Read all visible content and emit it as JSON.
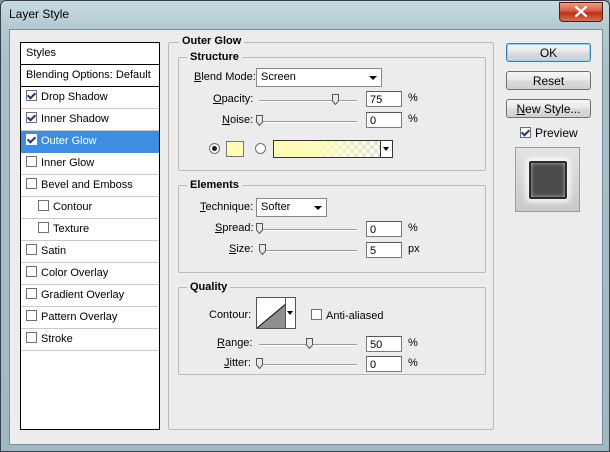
{
  "window": {
    "title": "Layer Style"
  },
  "styles_panel": {
    "header": "Styles",
    "blending_options": "Blending Options: Default",
    "items": [
      {
        "label": "Drop Shadow",
        "checked": true,
        "selected": false,
        "indent": false
      },
      {
        "label": "Inner Shadow",
        "checked": true,
        "selected": false,
        "indent": false
      },
      {
        "label": "Outer Glow",
        "checked": true,
        "selected": true,
        "indent": false
      },
      {
        "label": "Inner Glow",
        "checked": false,
        "selected": false,
        "indent": false
      },
      {
        "label": "Bevel and Emboss",
        "checked": false,
        "selected": false,
        "indent": false
      },
      {
        "label": "Contour",
        "checked": false,
        "selected": false,
        "indent": true
      },
      {
        "label": "Texture",
        "checked": false,
        "selected": false,
        "indent": true
      },
      {
        "label": "Satin",
        "checked": false,
        "selected": false,
        "indent": false
      },
      {
        "label": "Color Overlay",
        "checked": false,
        "selected": false,
        "indent": false
      },
      {
        "label": "Gradient Overlay",
        "checked": false,
        "selected": false,
        "indent": false
      },
      {
        "label": "Pattern Overlay",
        "checked": false,
        "selected": false,
        "indent": false
      },
      {
        "label": "Stroke",
        "checked": false,
        "selected": false,
        "indent": false
      }
    ]
  },
  "outer_glow": {
    "title": "Outer Glow",
    "structure": {
      "title": "Structure",
      "blend_mode_label": "Blend Mode:",
      "blend_mode_value": "Screen",
      "opacity_label": "Opacity:",
      "opacity_value": "75",
      "opacity_unit": "%",
      "noise_label": "Noise:",
      "noise_value": "0",
      "noise_unit": "%",
      "glow_color": "#fefcb8"
    },
    "elements": {
      "title": "Elements",
      "technique_label": "Technique:",
      "technique_value": "Softer",
      "spread_label": "Spread:",
      "spread_value": "0",
      "spread_unit": "%",
      "size_label": "Size:",
      "size_value": "5",
      "size_unit": "px"
    },
    "quality": {
      "title": "Quality",
      "contour_label": "Contour:",
      "anti_aliased_label": "Anti-aliased",
      "range_label": "Range:",
      "range_value": "50",
      "range_unit": "%",
      "jitter_label": "Jitter:",
      "jitter_value": "0",
      "jitter_unit": "%"
    }
  },
  "buttons": {
    "ok": "OK",
    "reset": "Reset",
    "new_style": "New Style...",
    "preview_label": "Preview"
  },
  "colors": {
    "selection": "#3d8ee0",
    "glow": "#fefcb8"
  }
}
